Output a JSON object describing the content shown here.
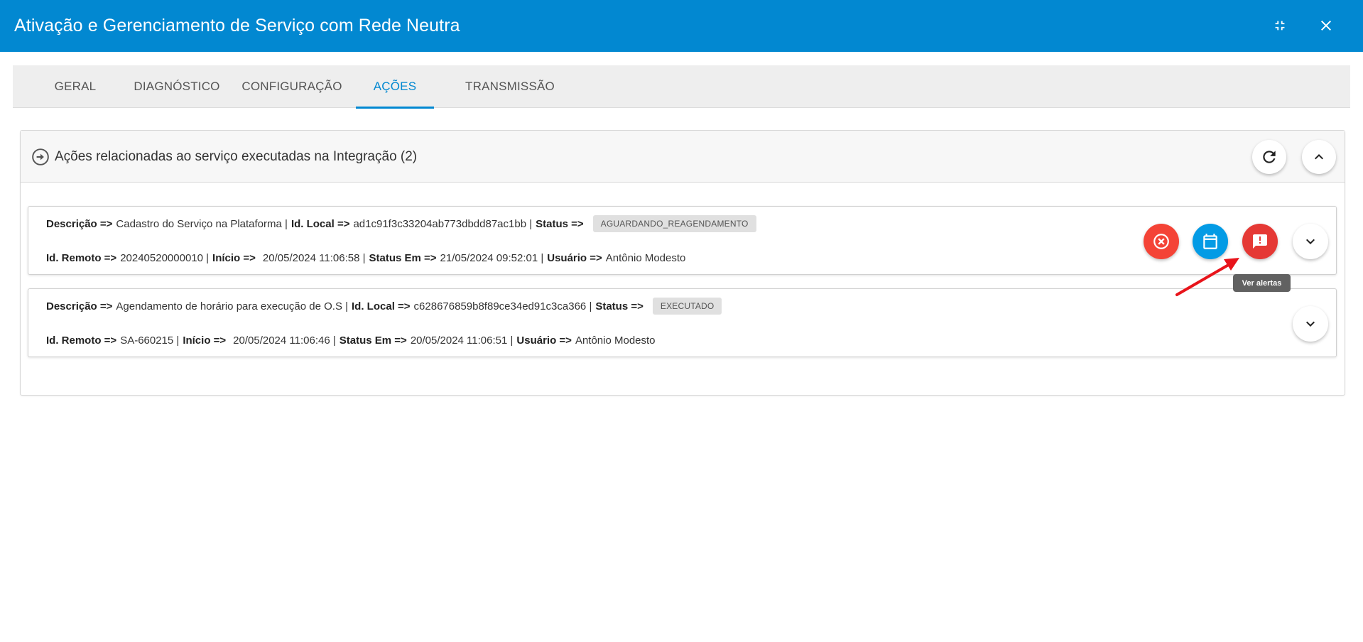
{
  "window": {
    "title": "Ativação e Gerenciamento de Serviço com Rede Neutra",
    "collapse_icon": "collapse-icon",
    "close_icon": "close-icon",
    "header_color": "#0288d1"
  },
  "tabs": [
    {
      "label": "GERAL",
      "active": false
    },
    {
      "label": "DIAGNÓSTICO",
      "active": false
    },
    {
      "label": "CONFIGURAÇÃO",
      "active": false
    },
    {
      "label": "AÇÕES",
      "active": true
    },
    {
      "label": "TRANSMISSÃO",
      "active": false
    }
  ],
  "panel": {
    "title": "Ações relacionadas ao serviço executadas na Integração (2)",
    "icon": "arrow-circle-right-icon",
    "refresh_icon": "refresh-icon",
    "collapse_icon": "chevron-up-icon"
  },
  "actions": [
    {
      "descricao_label": "Descrição =>",
      "descricao": "Cadastro do Serviço na Plataforma |",
      "id_local_label": "Id. Local =>",
      "id_local": "ad1c91f3c33204ab773dbdd87ac1bb |",
      "status_label": "Status =>",
      "status": "AGUARDANDO_REAGENDAMENTO",
      "id_remoto_label": "Id. Remoto =>",
      "id_remoto": "20240520000010 |",
      "inicio_label": "Início =>",
      "inicio": "20/05/2024 11:06:58 |",
      "status_em_label": "Status Em =>",
      "status_em": "21/05/2024 09:52:01 |",
      "usuario_label": "Usuário =>",
      "usuario": "Antônio Modesto",
      "buttons": [
        "cancel-icon",
        "calendar-icon",
        "alert-icon",
        "chevron-down-icon"
      ]
    },
    {
      "descricao_label": "Descrição =>",
      "descricao": "Agendamento de horário para execução de O.S |",
      "id_local_label": "Id. Local =>",
      "id_local": "c628676859b8f89ce34ed91c3ca366 |",
      "status_label": "Status =>",
      "status": "EXECUTADO",
      "id_remoto_label": "Id. Remoto =>",
      "id_remoto": "SA-660215 |",
      "inicio_label": "Início =>",
      "inicio": "20/05/2024 11:06:46 |",
      "status_em_label": "Status Em =>",
      "status_em": "20/05/2024 11:06:51 |",
      "usuario_label": "Usuário =>",
      "usuario": "Antônio Modesto",
      "buttons": [
        "chevron-down-icon"
      ]
    }
  ],
  "tooltip": {
    "text": "Ver alertas"
  },
  "colors": {
    "cancel": "#f44336",
    "calendar": "#039be5",
    "alert": "#e53935",
    "annotation_arrow": "#e8141b"
  }
}
